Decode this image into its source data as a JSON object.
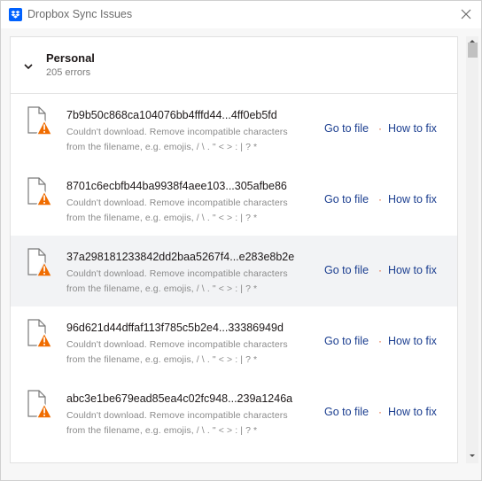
{
  "window": {
    "title": "Dropbox Sync Issues",
    "app_icon": "dropbox-icon",
    "close_icon": "close-icon"
  },
  "group": {
    "name": "Personal",
    "count": "205 errors",
    "expanded": true,
    "chevron_icon": "chevron-down-icon"
  },
  "error_line1": "Couldn't download. Remove incompatible characters",
  "error_line2": "from the filename, e.g. emojis, / \\ . \" < > : | ? *",
  "actions": {
    "go_to_file": "Go to file",
    "separator": "·",
    "how_to_fix": "How to fix"
  },
  "rows": [
    {
      "filename": "7b9b50c868ca104076bb4fffd44...4ff0eb5fd",
      "error_line1": "Couldn't download. Remove incompatible characters",
      "error_line2": "from the filename, e.g. emojis, / \\ . \" < > : | ? *"
    },
    {
      "filename": "8701c6ecbfb44ba9938f4aee103...305afbe86",
      "error_line1": "Couldn't download. Remove incompatible characters",
      "error_line2": "from the filename, e.g. emojis, / \\ . \" < > : | ? *"
    },
    {
      "filename": "37a298181233842dd2baa5267f4...e283e8b2e",
      "error_line1": "Couldn't download. Remove incompatible characters",
      "error_line2": "from the filename, e.g. emojis, / \\ . \" < > : | ? *"
    },
    {
      "filename": "96d621d44dffaf113f785c5b2e4...33386949d",
      "error_line1": "Couldn't download. Remove incompatible characters",
      "error_line2": "from the filename, e.g. emojis, / \\ . \" < > : | ? *"
    },
    {
      "filename": "abc3e1be679ead85ea4c02fc948...239a1246a",
      "error_line1": "Couldn't download. Remove incompatible characters",
      "error_line2": "from the filename, e.g. emojis, / \\ . \" < > : | ? *"
    }
  ],
  "colors": {
    "link": "#1a3d8f",
    "warning": "#f06c00",
    "brand": "#0061fe",
    "separator": "#e05a2a"
  },
  "icons": {
    "file": "file-warning-icon",
    "scroll_up": "scroll-up-arrow-icon",
    "scroll_down": "scroll-down-arrow-icon"
  }
}
